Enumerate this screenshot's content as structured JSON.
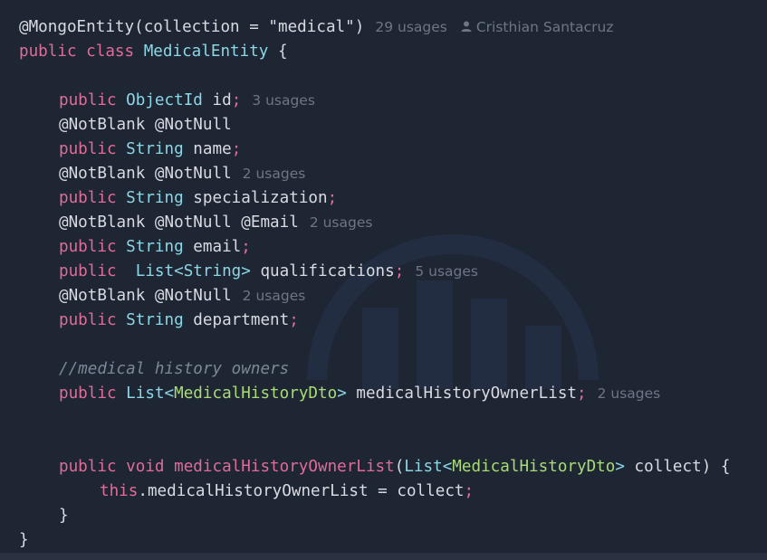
{
  "code": {
    "line1": {
      "annotation": "@MongoEntity",
      "paren_open": "(",
      "param": "collection = ",
      "value": "\"medical\"",
      "paren_close": ")",
      "usages": "29 usages",
      "author_icon": "person-icon",
      "author": "Cristhian Santacruz"
    },
    "line2": {
      "kw": "public class ",
      "name": "MedicalEntity",
      "brace": " {"
    },
    "line4": {
      "kw": "public ",
      "type": "ObjectId",
      "name": " id",
      "semi": ";",
      "usages": "3 usages"
    },
    "line5": {
      "ann": "@NotBlank @NotNull"
    },
    "line6": {
      "kw": "public ",
      "type": "String",
      "name": " name",
      "semi": ";"
    },
    "line7": {
      "ann": "@NotBlank @NotNull",
      "usages": "2 usages"
    },
    "line8": {
      "kw": "public ",
      "type": "String",
      "name": " specialization",
      "semi": ";"
    },
    "line9": {
      "ann": "@NotBlank @NotNull @Email",
      "usages": "2 usages"
    },
    "line10": {
      "kw": "public ",
      "type": "String",
      "name": " email",
      "semi": ";"
    },
    "line11": {
      "kw": "public  ",
      "type": "List<String>",
      "name": " qualifications",
      "semi": ";",
      "usages": "5 usages"
    },
    "line12": {
      "ann": "@NotBlank @NotNull",
      "usages": "2 usages"
    },
    "line13": {
      "kw": "public ",
      "type": "String",
      "name": " department",
      "semi": ";"
    },
    "line15": {
      "comment": "//medical history owners"
    },
    "line16": {
      "kw": "public ",
      "type1": "List<",
      "type2": "MedicalHistoryDto",
      "type3": ">",
      "name": " medicalHistoryOwnerList",
      "semi": ";",
      "usages": "2 usages"
    },
    "line19": {
      "kw": "public void ",
      "method": "medicalHistoryOwnerList",
      "p1": "(",
      "type1": "List<",
      "type2": "MedicalHistoryDto",
      "type3": ">",
      "param": " collect) {"
    },
    "line20": {
      "kw": "this",
      "rest": ".medicalHistoryOwnerList = collect",
      "semi": ";"
    },
    "line21": {
      "brace": "}"
    },
    "line22": {
      "brace": "}"
    }
  }
}
